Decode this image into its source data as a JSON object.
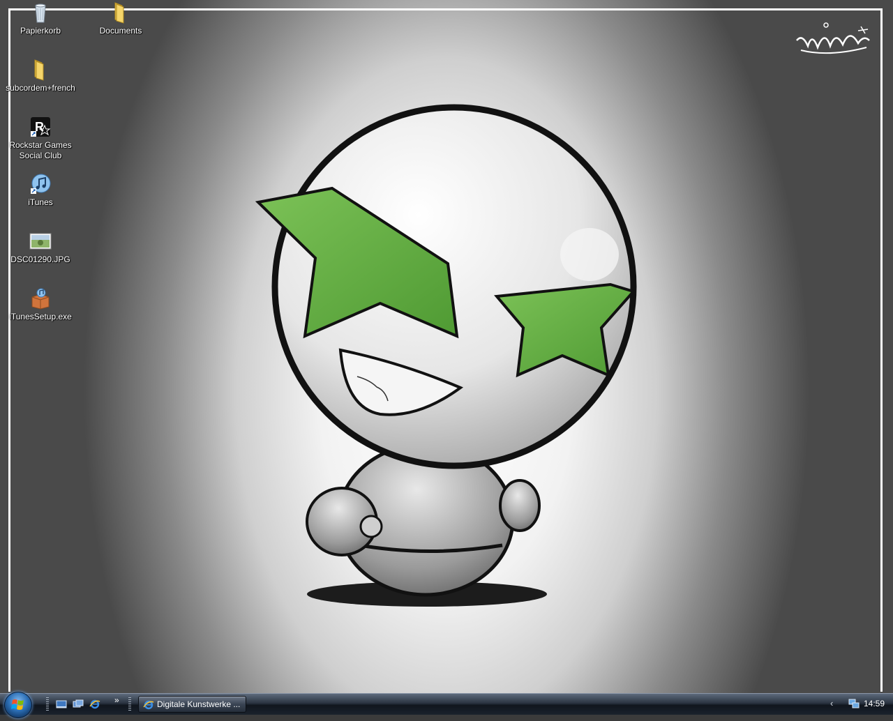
{
  "desktop": {
    "icons": [
      {
        "label": "Papierkorb",
        "icon": "recycle-bin-icon"
      },
      {
        "label": "Documents",
        "icon": "folder-icon"
      },
      {
        "label": "subcordem+french",
        "icon": "folder-icon"
      },
      {
        "label": "Rockstar Games Social Club",
        "icon": "rockstar-icon"
      },
      {
        "label": "iTunes",
        "icon": "itunes-shortcut-icon"
      },
      {
        "label": "DSC01290.JPG",
        "icon": "image-file-icon"
      },
      {
        "label": "iTunesSetup.exe",
        "icon": "installer-icon"
      }
    ]
  },
  "taskbar": {
    "quick_launch": [
      "show-desktop-icon",
      "switch-windows-icon",
      "internet-explorer-icon"
    ],
    "overflow": "»",
    "task_button": "Digitale Kunstwerke ...",
    "tray_arrow": "‹",
    "clock": "14:59"
  },
  "colors": {
    "wallpaper_accent_green": "#6ab04c",
    "taskbar_dark": "#1a222d"
  }
}
